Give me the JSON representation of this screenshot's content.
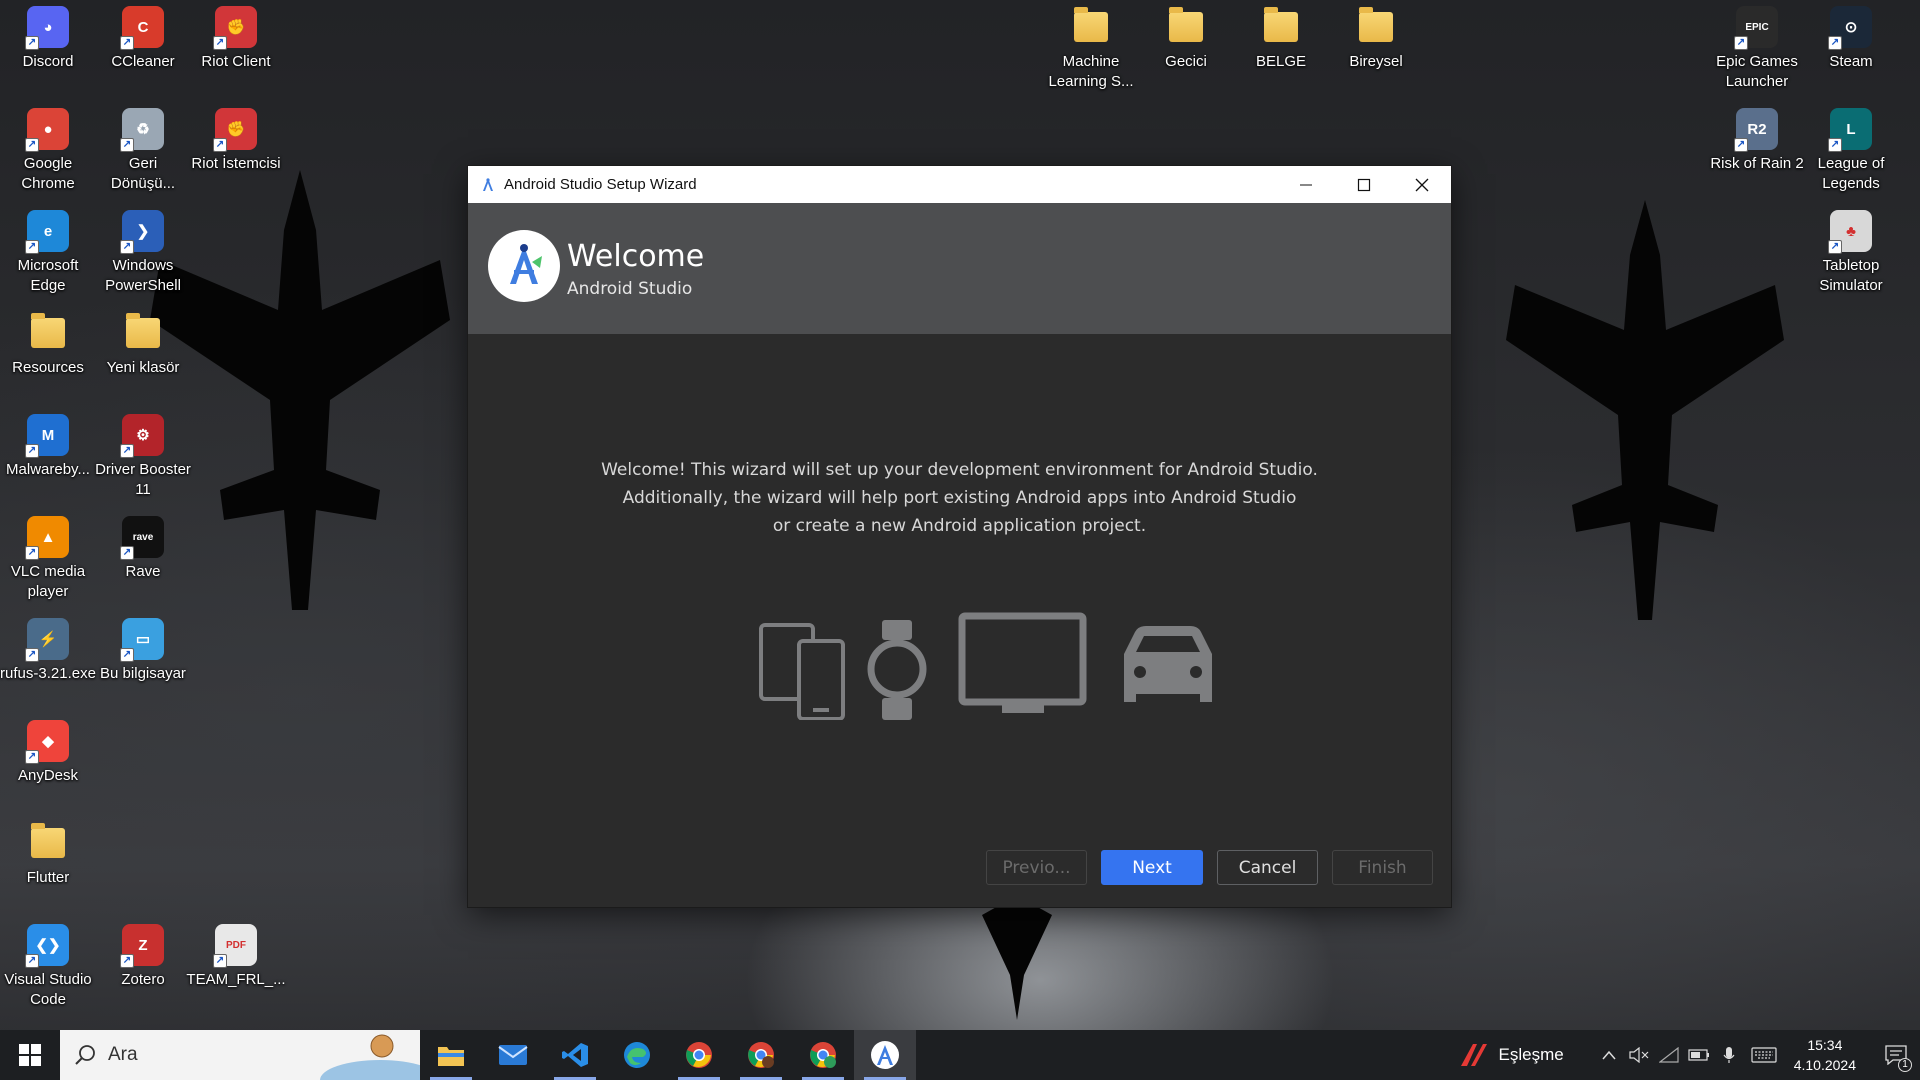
{
  "desktop": {
    "icons": [
      {
        "label": "Discord",
        "icon": "discord-icon"
      },
      {
        "label": "CCleaner",
        "icon": "ccleaner-icon"
      },
      {
        "label": "Riot Client",
        "icon": "riot-client-icon"
      },
      {
        "label": "Google Chrome",
        "icon": "chrome-icon"
      },
      {
        "label": "Geri Dönüşü...",
        "icon": "recycle-bin-icon"
      },
      {
        "label": "Riot İstemcisi",
        "icon": "riot-client-icon"
      },
      {
        "label": "Microsoft Edge",
        "icon": "edge-icon"
      },
      {
        "label": "Windows PowerShell",
        "icon": "powershell-icon"
      },
      {
        "label": "Resources",
        "icon": "folder-icon"
      },
      {
        "label": "Yeni klasör",
        "icon": "folder-icon"
      },
      {
        "label": "Malwareby...",
        "icon": "malwarebytes-icon"
      },
      {
        "label": "Driver Booster 11",
        "icon": "driver-booster-icon"
      },
      {
        "label": "VLC media player",
        "icon": "vlc-icon"
      },
      {
        "label": "Rave",
        "icon": "rave-icon"
      },
      {
        "label": "rufus-3.21.exe",
        "icon": "rufus-icon"
      },
      {
        "label": "Bu bilgisayar",
        "icon": "this-pc-icon"
      },
      {
        "label": "AnyDesk",
        "icon": "anydesk-icon"
      },
      {
        "label": "Flutter",
        "icon": "folder-icon"
      },
      {
        "label": "Visual Studio Code",
        "icon": "vscode-icon"
      },
      {
        "label": "Zotero",
        "icon": "zotero-icon"
      },
      {
        "label": "TEAM_FRL_...",
        "icon": "pdf-icon"
      },
      {
        "label": "Machine Learning S...",
        "icon": "folder-icon"
      },
      {
        "label": "Gecici",
        "icon": "folder-icon"
      },
      {
        "label": "BELGE",
        "icon": "folder-icon"
      },
      {
        "label": "Bireysel",
        "icon": "folder-icon"
      },
      {
        "label": "Epic Games Launcher",
        "icon": "epic-games-icon"
      },
      {
        "label": "Steam",
        "icon": "steam-icon"
      },
      {
        "label": "Risk of Rain 2",
        "icon": "risk-of-rain-icon"
      },
      {
        "label": "League of Legends",
        "icon": "league-of-legends-icon"
      },
      {
        "label": "Tabletop Simulator",
        "icon": "tabletop-simulator-icon"
      }
    ]
  },
  "wizard": {
    "window_title": "Android Studio Setup Wizard",
    "header_title": "Welcome",
    "header_subtitle": "Android Studio",
    "body_lines": [
      "Welcome! This wizard will set up your development environment for Android Studio.",
      "Additionally, the wizard will help port existing Android apps into Android Studio",
      "or create a new Android application project."
    ],
    "device_icons": [
      "phone-tablet-icon",
      "watch-icon",
      "tv-icon",
      "car-icon"
    ],
    "buttons": {
      "previous": "Previo...",
      "next": "Next",
      "cancel": "Cancel",
      "finish": "Finish"
    },
    "colors": {
      "primary_button": "#3574f0",
      "header_bg": "#4d4e50",
      "body_bg": "#2b2b2b"
    }
  },
  "taskbar": {
    "search_placeholder": "Ara",
    "apps": [
      "file-explorer-icon",
      "mail-icon",
      "vscode-icon",
      "edge-icon",
      "chrome-icon",
      "chrome-profile-icon",
      "chrome-profile-icon",
      "android-studio-icon"
    ],
    "tray": {
      "news_label": "Eşleşme",
      "time": "15:34",
      "date": "4.10.2024",
      "notification_count": "1"
    }
  }
}
